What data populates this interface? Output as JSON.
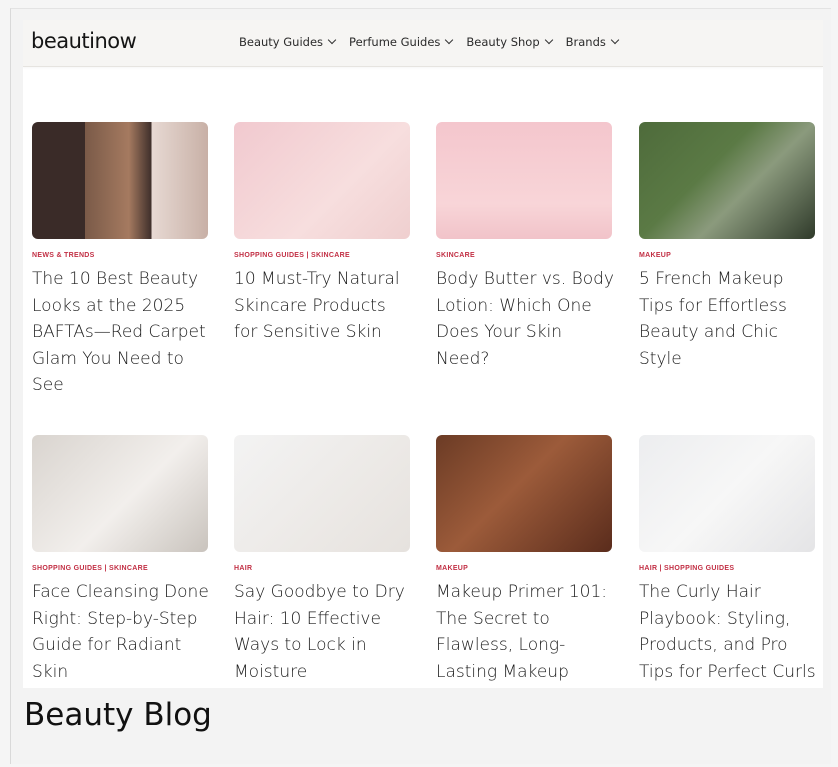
{
  "header": {
    "logo": "beautinow",
    "nav": [
      {
        "label": "Beauty Guides"
      },
      {
        "label": "Perfume Guides"
      },
      {
        "label": "Beauty Shop"
      },
      {
        "label": "Brands"
      }
    ]
  },
  "posts": [
    {
      "category": "NEWS & TRENDS",
      "title": "The 10 Best Beauty Looks at the 2025 BAFTAs—Red Carpet Glam You Need to See"
    },
    {
      "category": "SHOPPING GUIDES | SKINCARE",
      "title": "10 Must-Try Natural Skincare Products for Sensitive Skin"
    },
    {
      "category": "SKINCARE",
      "title": "Body Butter vs. Body Lotion: Which One Does Your Skin Need?"
    },
    {
      "category": "MAKEUP",
      "title": "5 French Makeup Tips for Effortless Beauty and Chic Style"
    },
    {
      "category": "SHOPPING GUIDES | SKINCARE",
      "title": "Face Cleansing Done Right: Step-by-Step Guide for Radiant Skin"
    },
    {
      "category": "HAIR",
      "title": "Say Goodbye to Dry Hair: 10 Effective Ways to Lock in Moisture"
    },
    {
      "category": "MAKEUP",
      "title": "Makeup Primer 101: The Secret to Flawless, Long-Lasting Makeup"
    },
    {
      "category": "HAIR | SHOPPING GUIDES",
      "title": "The Curly Hair Playbook: Styling, Products, and Pro Tips for Perfect Curls"
    }
  ],
  "caption": "Beauty Blog"
}
